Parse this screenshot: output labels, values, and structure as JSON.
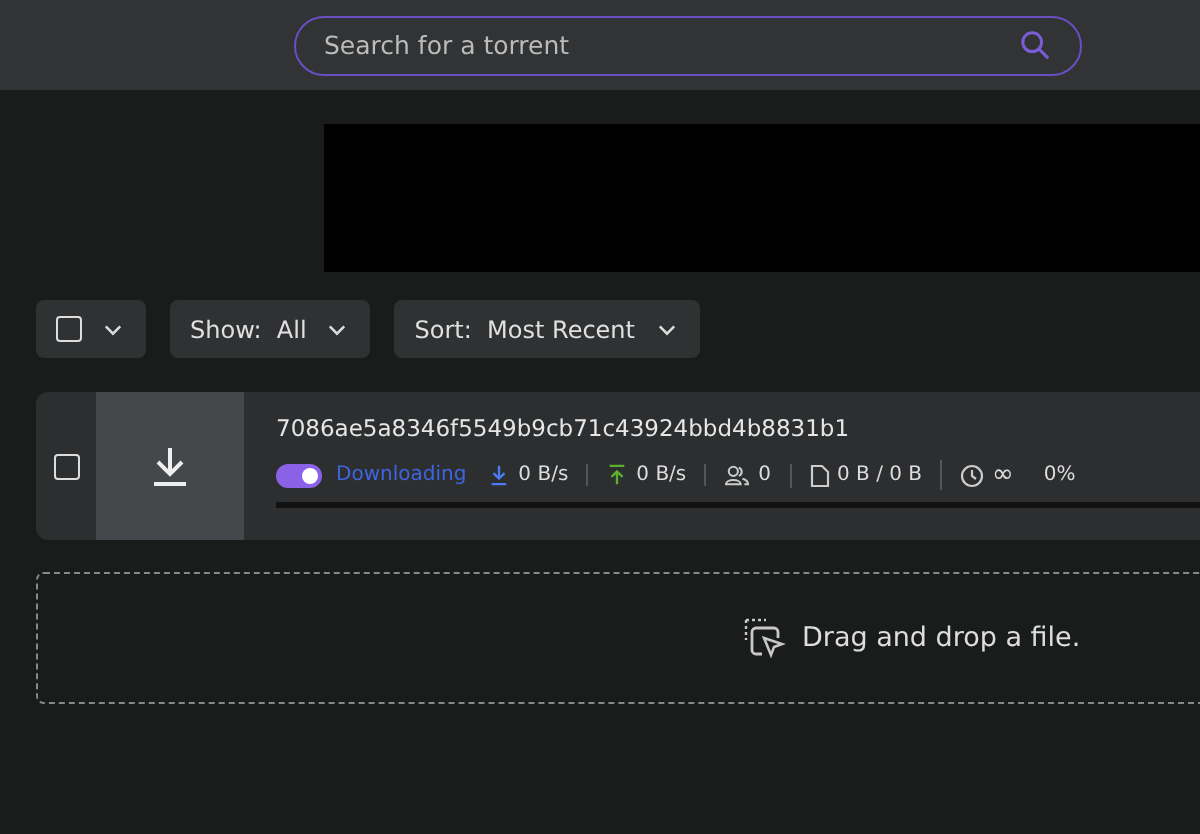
{
  "search": {
    "placeholder": "Search for a torrent"
  },
  "toolbar": {
    "select_all": {
      "checked": false
    },
    "filters": [
      {
        "label": "Show:",
        "value": "All"
      },
      {
        "label": "Sort:",
        "value": "Most Recent"
      }
    ]
  },
  "torrents": [
    {
      "checked": false,
      "name": "7086ae5a8346f5549b9cb71c43924bbd4b8831b1",
      "on": true,
      "status": "Downloading",
      "download_speed": "0 B/s",
      "upload_speed": "0 B/s",
      "peers": "0",
      "size": "0 B / 0 B",
      "eta": "∞",
      "percent": "0%",
      "level": 0
    }
  ],
  "dropzone": {
    "text": "Drag and drop a file."
  }
}
